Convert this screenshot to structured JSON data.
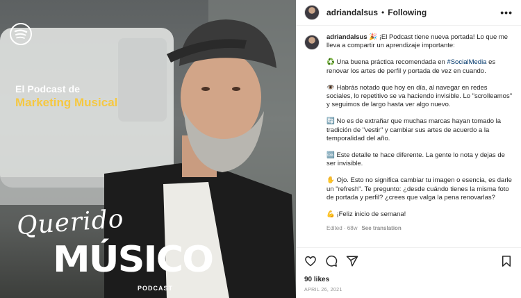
{
  "media": {
    "podcast_prefix": "El Podcast de",
    "podcast_title": "Marketing Musical",
    "script_word": "Querido",
    "big_word": "MÚSICO",
    "tag": "PODCAST",
    "logo_icon": "spotify-icon",
    "colors": {
      "title_accent": "#f5c842"
    }
  },
  "post": {
    "username": "adriandalsus",
    "separator": "•",
    "follow_status": "Following",
    "more_icon": "more-horizontal-icon",
    "caption_user": "adriandalsus",
    "caption": {
      "p1": "🎉 ¡El Podcast tiene nueva portada! Lo que me lleva a compartir un aprendizaje importante:",
      "p2_pre": "♻️ Una buena práctica recomendada en ",
      "p2_tag": "#SocialMedia",
      "p2_post": " es renovar los artes de perfil y portada de vez en cuando.",
      "p3": "👁️ Habrás notado que hoy en día, al navegar en redes sociales, lo repetitivo se va haciendo invisible. Lo \"scrolleamos\" y seguimos de largo hasta ver algo nuevo.",
      "p4": "🔄 No es de extrañar que muchas marcas hayan tomado la tradición de \"vestir\" y cambiar sus artes de acuerdo a la temporalidad del año.",
      "p5": "🆒 Este detalle te hace diferente. La gente lo nota y dejas de ser invisible.",
      "p6": "✋ Ojo. Esto no significa cambiar tu imagen o esencia, es darle un \"refresh\". Te pregunto: ¿desde cuándo tienes la misma foto de portada y perfil? ¿crees que valga la pena renovarlas?",
      "p7": "💪 ¡Feliz inicio de semana!"
    },
    "meta_edited": "Edited · 68w",
    "see_translation": "See translation",
    "likes": "90 likes",
    "date": "APRIL 26, 2021",
    "icons": [
      "heart-icon",
      "comment-icon",
      "share-icon",
      "bookmark-icon"
    ]
  }
}
